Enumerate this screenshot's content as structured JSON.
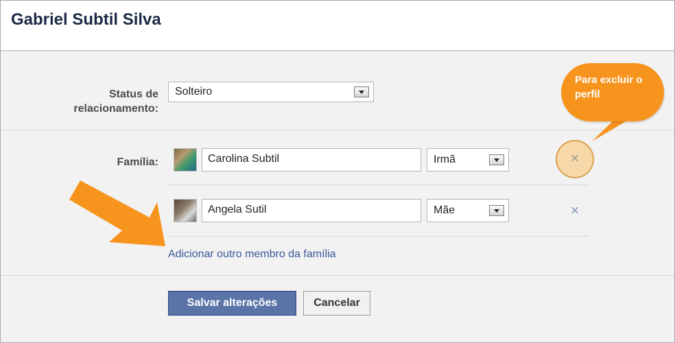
{
  "page": {
    "title": "Gabriel Subtil Silva"
  },
  "relationship": {
    "label": "Status de relacionamento:",
    "value": "Solteiro"
  },
  "family": {
    "label": "Família:",
    "members": [
      {
        "name": "Carolina Subtil",
        "relation": "Irmã",
        "remove_label": "×",
        "avatar_icon": "profile-photo"
      },
      {
        "name": "Angela Sutil",
        "relation": "Mãe",
        "remove_label": "×",
        "avatar_icon": "profile-photo"
      }
    ],
    "add_link": "Adicionar outro membro da família"
  },
  "annotation": {
    "callout_text": "Para excluir o perfil",
    "callout_color": "#f7941d",
    "arrow_color": "#f7941d"
  },
  "actions": {
    "save_label": "Salvar alterações",
    "cancel_label": "Cancelar"
  },
  "colors": {
    "title": "#1c2a47",
    "link": "#3b5998",
    "primary_button": "#5b74a8"
  }
}
